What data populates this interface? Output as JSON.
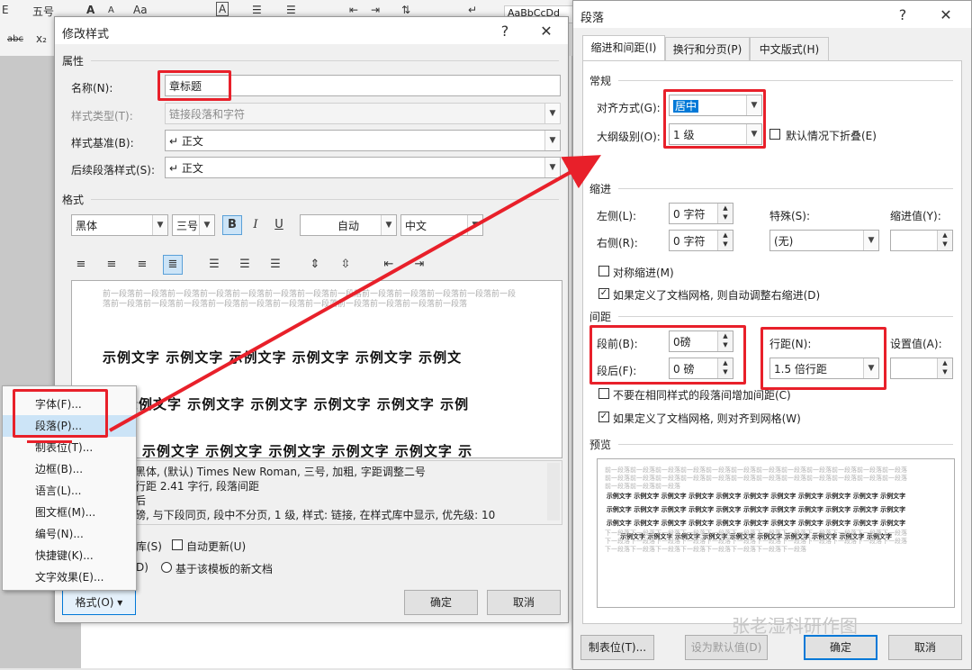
{
  "ribbon": {
    "row1": [
      "E",
      "五号",
      "A",
      "A",
      "Aa",
      "A",
      "A",
      "AaBbCcDd"
    ],
    "row2": [
      "abc",
      "x₂"
    ]
  },
  "modify": {
    "title": "修改样式",
    "help": "?",
    "close": "✕",
    "props_label": "属性",
    "name_label": "名称(N):",
    "name_value": "章标题",
    "type_label": "样式类型(T):",
    "type_value": "链接段落和字符",
    "base_label": "样式基准(B):",
    "base_value": "↵ 正文",
    "next_label": "后续段落样式(S):",
    "next_value": "↵ 正文",
    "format_label": "格式",
    "font": "黑体",
    "size": "三号",
    "bold": "B",
    "italic": "I",
    "underline": "U",
    "color": "自动",
    "lang": "中文",
    "preview_prev": "前一段落前一段落前一段落前一段落前一段落前一段落前一段落前一段落前一段落前一段落前一段落前一段落前一段落前一段落前一段落前一段落前一段落前一段落前一段落前一段落前一段落前一段落前一段落前一段落",
    "sample_lines": [
      "示例文字 示例文字 示例文字 示例文字 示例文字 示例文",
      "示例文字 示例文字 示例文字 示例文字 示例文字 示例",
      "示例文字 示例文字 示例文字 示例文字 示例文字 示"
    ],
    "desc_lines": [
      "黑体, (默认) Times New Roman, 三号, 加粗, 字距调整二号",
      "行距 2.41 字行, 段落间距",
      "后",
      "磅, 与下段同页, 段中不分页, 1 级, 样式: 链接, 在样式库中显示, 优先级: 10"
    ],
    "add_gallery": "库(S)",
    "auto_update": "自动更新(U)",
    "only_doc": "D)",
    "new_docs": "基于该模板的新文档",
    "format_btn": "格式(O) ▾",
    "ok": "确定",
    "cancel": "取消"
  },
  "menu": {
    "items": [
      "字体(F)...",
      "段落(P)...",
      "制表位(T)...",
      "边框(B)...",
      "语言(L)...",
      "图文框(M)...",
      "编号(N)...",
      "快捷键(K)...",
      "文字效果(E)..."
    ]
  },
  "para": {
    "title": "段落",
    "help": "?",
    "close": "✕",
    "tabs": [
      "缩进和间距(I)",
      "换行和分页(P)",
      "中文版式(H)"
    ],
    "general": "常规",
    "align_label": "对齐方式(G):",
    "align_value": "居中",
    "outline_label": "大纲级别(O):",
    "outline_value": "1 级",
    "collapse": "默认情况下折叠(E)",
    "indent": "缩进",
    "left_label": "左侧(L):",
    "left_value": "0 字符",
    "right_label": "右侧(R):",
    "right_value": "0 字符",
    "special_label": "特殊(S):",
    "special_value": "(无)",
    "indent_by_label": "缩进值(Y):",
    "mirror": "对称缩进(M)",
    "auto_right": "如果定义了文档网格, 则自动调整右缩进(D)",
    "spacing": "间距",
    "before_label": "段前(B):",
    "before_value": "0磅",
    "after_label": "段后(F):",
    "after_value": "0 磅",
    "line_label": "行距(N):",
    "line_value": "1.5 倍行距",
    "at_label": "设置值(A):",
    "no_space": "不要在相同样式的段落间增加间距(C)",
    "snap_grid": "如果定义了文档网格, 则对齐到网格(W)",
    "preview": "预览",
    "preview_prev": "前一段落前一段落前一段落前一段落前一段落前一段落前一段落前一段落前一段落前一段落前一段落前一段落前一段落前一段落前一段落前一段落前一段落前一段落前一段落前一段落前一段落前一段落前一段落前一段落前一段落前一段落前一段落",
    "preview_sample": "示例文字 示例文字 示例文字 示例文字 示例文字 示例文字 示例文字 示例文字 示例文字 示例文字 示例文字 示例文字 示例文字 示例文字 示例文字 示例文字 示例文字 示例文字 示例文字 示例文字 示例文字 示例文字 示例文字 示例文字 示例文字 示例文字 示例文字 示例文字 示例文字 示例文字 示例文字 示例文字 示例文字 示例文字 示例文字 示例文字 示例文字 示例文字 示例文字 示例文字 示例文字 示例文字 示例文字",
    "preview_next": "下一段落下一段落下一段落下一段落下一段落下一段落下一段落下一段落下一段落下一段落下一段落下一段落下一段落下一段落下一段落下一段落下一段落下一段落下一段落下一段落下一段落下一段落下一段落下一段落下一段落下一段落下一段落下一段落下一段落下一段落下一段落下一段落",
    "tabs_btn": "制表位(T)...",
    "default_btn": "设为默认值(D)",
    "ok": "确定",
    "cancel": "取消"
  },
  "watermark": "张老湿科研作图",
  "colors": {
    "highlight": "#e8202a",
    "accent": "#0078d7"
  }
}
